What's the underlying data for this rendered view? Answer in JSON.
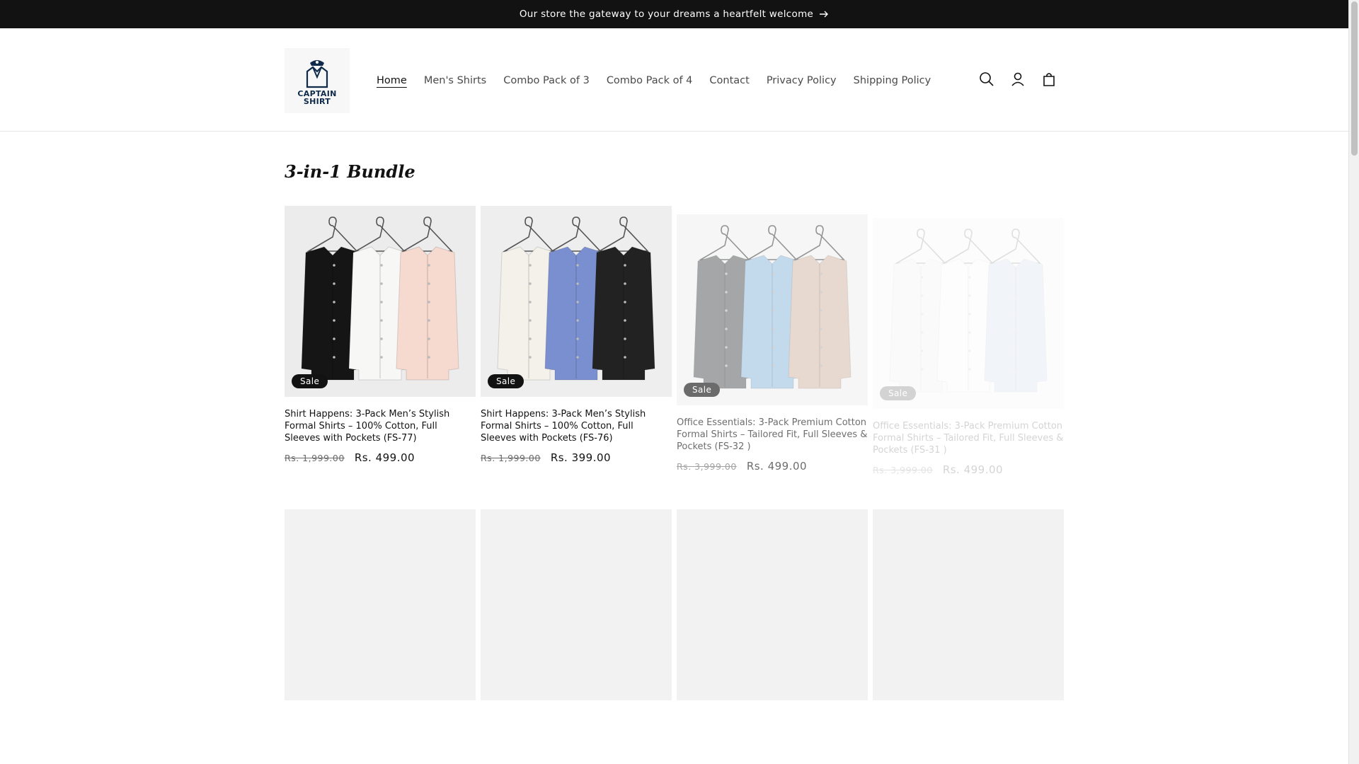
{
  "announcement": {
    "text": "Our store the gateway to your dreams a heartfelt welcome",
    "arrow_icon": "arrow-right-icon"
  },
  "logo": {
    "line1": "CAPTAIN",
    "line2": "SHIRT"
  },
  "nav": [
    {
      "label": "Home"
    },
    {
      "label": "Men's Shirts"
    },
    {
      "label": "Combo Pack of 3"
    },
    {
      "label": "Combo Pack of 4"
    },
    {
      "label": "Contact"
    },
    {
      "label": "Privacy Policy"
    },
    {
      "label": "Shipping Policy"
    }
  ],
  "header_icons": [
    "search-icon",
    "account-icon",
    "cart-icon"
  ],
  "collection": {
    "title": "3-in-1 Bundle"
  },
  "products": [
    {
      "badge": "Sale",
      "title": "Shirt Happens: 3-Pack Men’s Stylish Formal Shirts – 100% Cotton, Full Sleeves with Pockets (FS-77)",
      "old_price": "Rs. 1,999.00",
      "price": "Rs. 499.00",
      "shirt_colors": [
        "#151515",
        "#f7f7f5",
        "#f6d9cf"
      ]
    },
    {
      "badge": "Sale",
      "title": "Shirt Happens: 3-Pack Men’s Stylish Formal Shirts – 100% Cotton, Full Sleeves with Pockets (FS-76)",
      "old_price": "Rs. 1,999.00",
      "price": "Rs. 399.00",
      "shirt_colors": [
        "#f4f1ea",
        "#7a8fcf",
        "#222222"
      ]
    },
    {
      "badge": "Sale",
      "title": "Office Essentials: 3-Pack Premium Cotton Formal Shirts – Tailored Fit, Full Sleeves & Pockets (FS-32 )",
      "old_price": "Rs. 3,999.00",
      "price": "Rs. 499.00",
      "shirt_colors": [
        "#6f7072",
        "#9fc2e2",
        "#d9c2b3"
      ]
    },
    {
      "badge": "Sale",
      "title": "Office Essentials: 3-Pack Premium Cotton Formal Shirts – Tailored Fit, Full Sleeves & Pockets (FS-31 )",
      "old_price": "Rs. 3,999.00",
      "price": "Rs. 499.00",
      "shirt_colors": [
        "#e8e8e8",
        "#f5f5f5",
        "#b8c6de"
      ]
    }
  ]
}
